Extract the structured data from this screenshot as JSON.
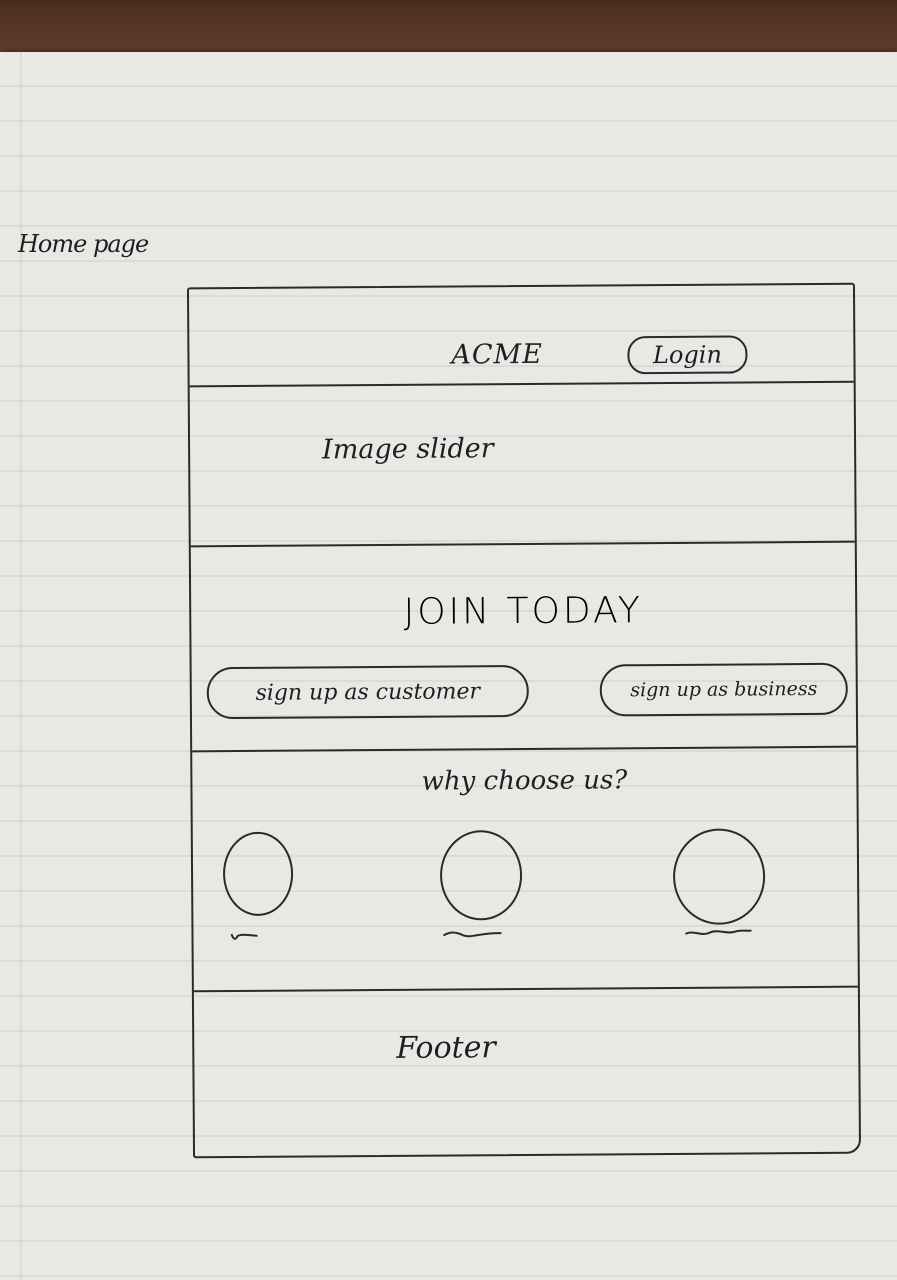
{
  "page_label": "Home page",
  "header": {
    "brand": "ACME",
    "login_label": "Login"
  },
  "slider": {
    "label": "Image slider"
  },
  "join": {
    "title": "JOIN TODAY",
    "customer_button": "sign up as customer",
    "business_button": "sign up as business"
  },
  "why": {
    "title": "why choose us?",
    "features": [
      {
        "icon": "circle-placeholder-icon"
      },
      {
        "icon": "circle-placeholder-icon"
      },
      {
        "icon": "circle-placeholder-icon"
      }
    ]
  },
  "footer": {
    "label": "Footer"
  }
}
